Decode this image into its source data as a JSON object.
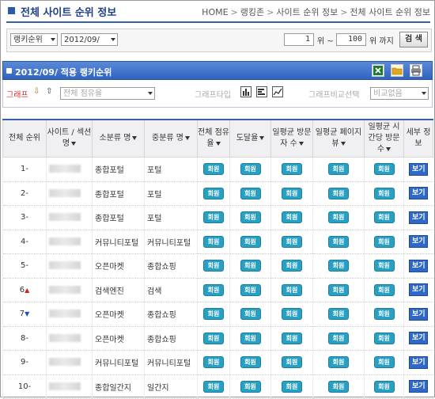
{
  "header": {
    "title": "전체 사이트 순위 정보",
    "breadcrumb": [
      "HOME",
      "랭킹존",
      "사이트 순위 정보",
      "전체 사이트 순위 정보"
    ],
    "breadcrumb_sep": ">"
  },
  "search": {
    "type_select": "랭키순위",
    "date_select": "2012/09/",
    "from_value": "1",
    "range_label_1": "위 ~",
    "to_value": "100",
    "range_label_2": "위 까지",
    "search_button": "검 색"
  },
  "panel": {
    "title": "2012/09/   적용 랭키순위",
    "graph_label": "그래프",
    "metric_select": "전체 점유율",
    "graph_type_label": "그래프타입",
    "graph_compare_label": "그래프비교선택",
    "compare_select": "비교없음",
    "up_arrow": "⇩",
    "down_arrow": "⇧"
  },
  "table": {
    "headers": [
      "전체 순위",
      "사이트 / 섹션 명",
      "소분류 명",
      "중분류 명",
      "전체 점유율",
      "도달율",
      "일평균 방문자 수",
      "일평균 페이지 뷰",
      "일평균 시간당 방문수",
      "세부 정보"
    ],
    "member_label": "회원",
    "detail_label": "보기",
    "rows": [
      {
        "rank": "1",
        "trend": "-",
        "small": "종합포털",
        "mid": "포털"
      },
      {
        "rank": "2",
        "trend": "-",
        "small": "종합포털",
        "mid": "포털"
      },
      {
        "rank": "3",
        "trend": "-",
        "small": "종합포털",
        "mid": "포털"
      },
      {
        "rank": "4",
        "trend": "-",
        "small": "커뮤니티포털",
        "mid": "커뮤니티포털"
      },
      {
        "rank": "5",
        "trend": "-",
        "small": "오픈마켓",
        "mid": "종합쇼핑"
      },
      {
        "rank": "6",
        "trend": "▲",
        "small": "검색엔진",
        "mid": "검색"
      },
      {
        "rank": "7",
        "trend": "▼",
        "small": "오픈마켓",
        "mid": "종합쇼핑"
      },
      {
        "rank": "8",
        "trend": "-",
        "small": "오픈마켓",
        "mid": "종합쇼핑"
      },
      {
        "rank": "9",
        "trend": "-",
        "small": "커뮤니티포털",
        "mid": "커뮤니티포털"
      },
      {
        "rank": "10",
        "trend": "-",
        "small": "종합일간지",
        "mid": "일간지"
      }
    ]
  },
  "colors": {
    "accent": "#3a62a8",
    "panel": "#2f63bf",
    "member_pill": "#27a0c4",
    "detail_btn": "#2e68c8",
    "graph_label": "#d03030"
  },
  "icons": {
    "excel": "excel-icon",
    "folder": "folder-icon",
    "print": "print-icon",
    "bar": "bar-chart-icon",
    "column": "column-chart-icon",
    "line": "line-chart-icon"
  }
}
